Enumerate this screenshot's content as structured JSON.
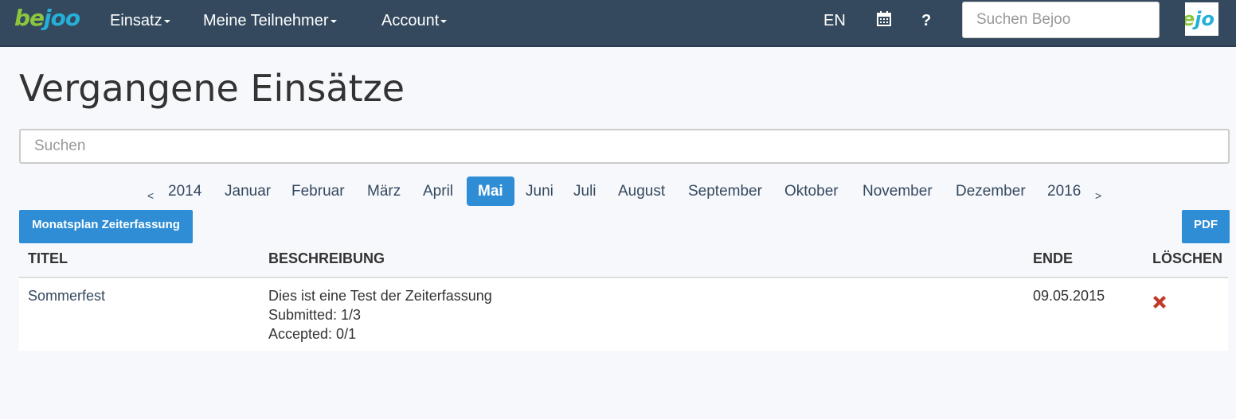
{
  "navbar": {
    "brand": {
      "part1": "be",
      "part2": "joo"
    },
    "menu": [
      {
        "label": "Einsatz"
      },
      {
        "label": "Meine Teilnehmer"
      },
      {
        "label": "Account"
      }
    ],
    "lang": "EN",
    "help": "?",
    "search_placeholder": "Suchen Bejoo",
    "logo": {
      "part1": "e",
      "part2": "jo"
    }
  },
  "page": {
    "title": "Vergangene Einsätze",
    "search_placeholder": "Suchen"
  },
  "pager": {
    "prev": "<",
    "next": ">",
    "prev_year": "2014",
    "next_year": "2016",
    "months": [
      "Januar",
      "Februar",
      "März",
      "April",
      "Mai",
      "Juni",
      "Juli",
      "August",
      "September",
      "Oktober",
      "November",
      "Dezember"
    ],
    "active_month": "Mai"
  },
  "buttons": {
    "monatsplan": "Monatsplan Zeiterfassung",
    "pdf": "PDF"
  },
  "table": {
    "headers": [
      "TITEL",
      "BESCHREIBUNG",
      "ENDE",
      "LÖSCHEN"
    ],
    "rows": [
      {
        "title": "Sommerfest",
        "description": [
          "Dies ist eine Test der Zeiterfassung",
          "Submitted: 1/3",
          "Accepted: 0/1"
        ],
        "end": "09.05.2015"
      }
    ]
  },
  "colors": {
    "navbar": "#34495e",
    "accent": "#2e8dd4",
    "delete": "#c0392b",
    "brand_green": "#8cc63f",
    "brand_blue": "#25b0d8"
  }
}
